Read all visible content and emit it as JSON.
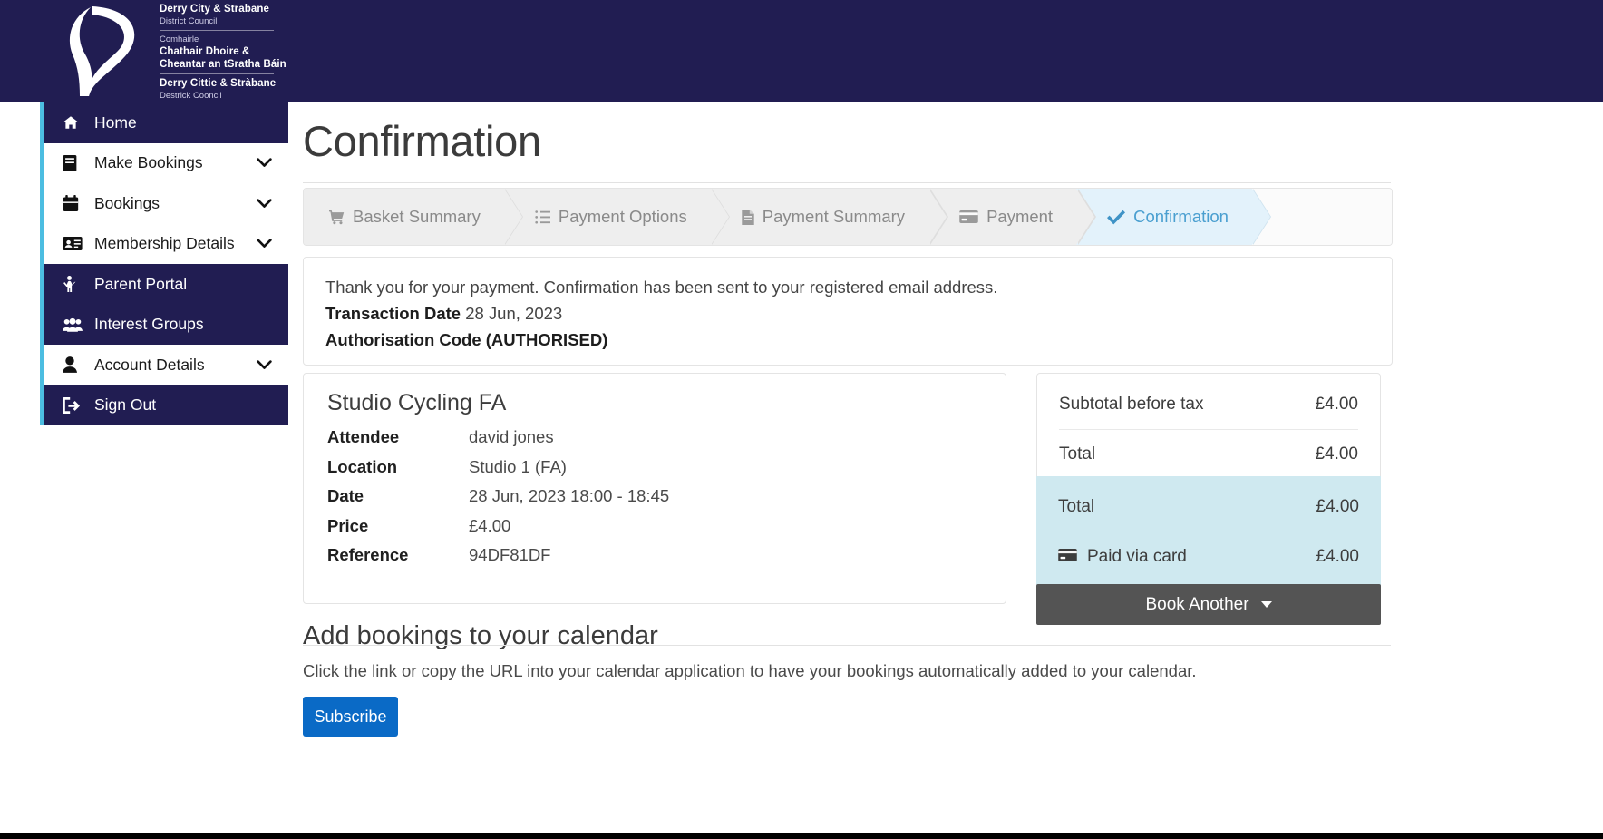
{
  "brand": {
    "logo_icon": "derry-strabane-swirl-logo",
    "line1_bold": "Derry City & Strabane",
    "line1_sub": "District Council",
    "line2_sub": "Comhairle",
    "line2_bold_a": "Chathair Dhoire &",
    "line2_bold_b": "Cheantar an tSratha Báin",
    "line3_bold": "Derry Cittie & Stràbane",
    "line3_sub": "Destrick Cooncil",
    "header_color": "#211d52",
    "accent_color": "#4cbde1"
  },
  "sidebar": {
    "items": [
      {
        "label": "Home",
        "icon": "home-icon",
        "active": true,
        "chevron": false
      },
      {
        "label": "Make Bookings",
        "icon": "book-icon",
        "active": false,
        "chevron": true
      },
      {
        "label": "Bookings",
        "icon": "calendar-icon",
        "active": false,
        "chevron": true
      },
      {
        "label": "Membership Details",
        "icon": "id-card-icon",
        "active": false,
        "chevron": true
      },
      {
        "label": "Parent Portal",
        "icon": "child-icon",
        "active": true,
        "chevron": false
      },
      {
        "label": "Interest Groups",
        "icon": "users-icon",
        "active": true,
        "chevron": false
      },
      {
        "label": "Account Details",
        "icon": "user-icon",
        "active": false,
        "chevron": true
      },
      {
        "label": "Sign Out",
        "icon": "sign-out-icon",
        "active": true,
        "chevron": false
      }
    ]
  },
  "page": {
    "title": "Confirmation"
  },
  "steps": [
    {
      "label": "Basket Summary",
      "icon": "shopping-cart-icon",
      "current": false
    },
    {
      "label": "Payment Options",
      "icon": "list-ol-icon",
      "current": false
    },
    {
      "label": "Payment Summary",
      "icon": "file-icon",
      "current": false
    },
    {
      "label": "Payment",
      "icon": "credit-card-icon",
      "current": false
    },
    {
      "label": "Confirmation",
      "icon": "check-icon",
      "current": true
    }
  ],
  "confirmation": {
    "thank_you": "Thank you for your payment. Confirmation has been sent to your registered email address.",
    "transaction_date_label": "Transaction Date",
    "transaction_date_value": "28 Jun, 2023",
    "authorisation_line": "Authorisation Code (AUTHORISED)"
  },
  "booking": {
    "title": "Studio Cycling FA",
    "rows": [
      {
        "key": "Attendee",
        "value": "david jones"
      },
      {
        "key": "Location",
        "value": "Studio 1 (FA)"
      },
      {
        "key": "Date",
        "value": "28 Jun, 2023 18:00 - 18:45"
      },
      {
        "key": "Price",
        "value": "£4.00"
      },
      {
        "key": "Reference",
        "value": "94DF81DF"
      }
    ]
  },
  "totals": {
    "rows": [
      {
        "label": "Subtotal before tax",
        "amount": "£4.00"
      },
      {
        "label": "Total",
        "amount": "£4.00"
      }
    ],
    "paid_rows": [
      {
        "label": "Total",
        "amount": "£4.00",
        "icon": ""
      },
      {
        "label": "Paid via card",
        "amount": "£4.00",
        "icon": "credit-card-icon"
      }
    ],
    "paid_bg": "#cfe9f0"
  },
  "actions": {
    "book_another": "Book Another"
  },
  "calendar": {
    "title": "Add bookings to your calendar",
    "description": "Click the link or copy the URL into your calendar application to have your bookings automatically added to your calendar.",
    "subscribe_label": "Subscribe",
    "subscribe_color": "#0a6ac6"
  }
}
